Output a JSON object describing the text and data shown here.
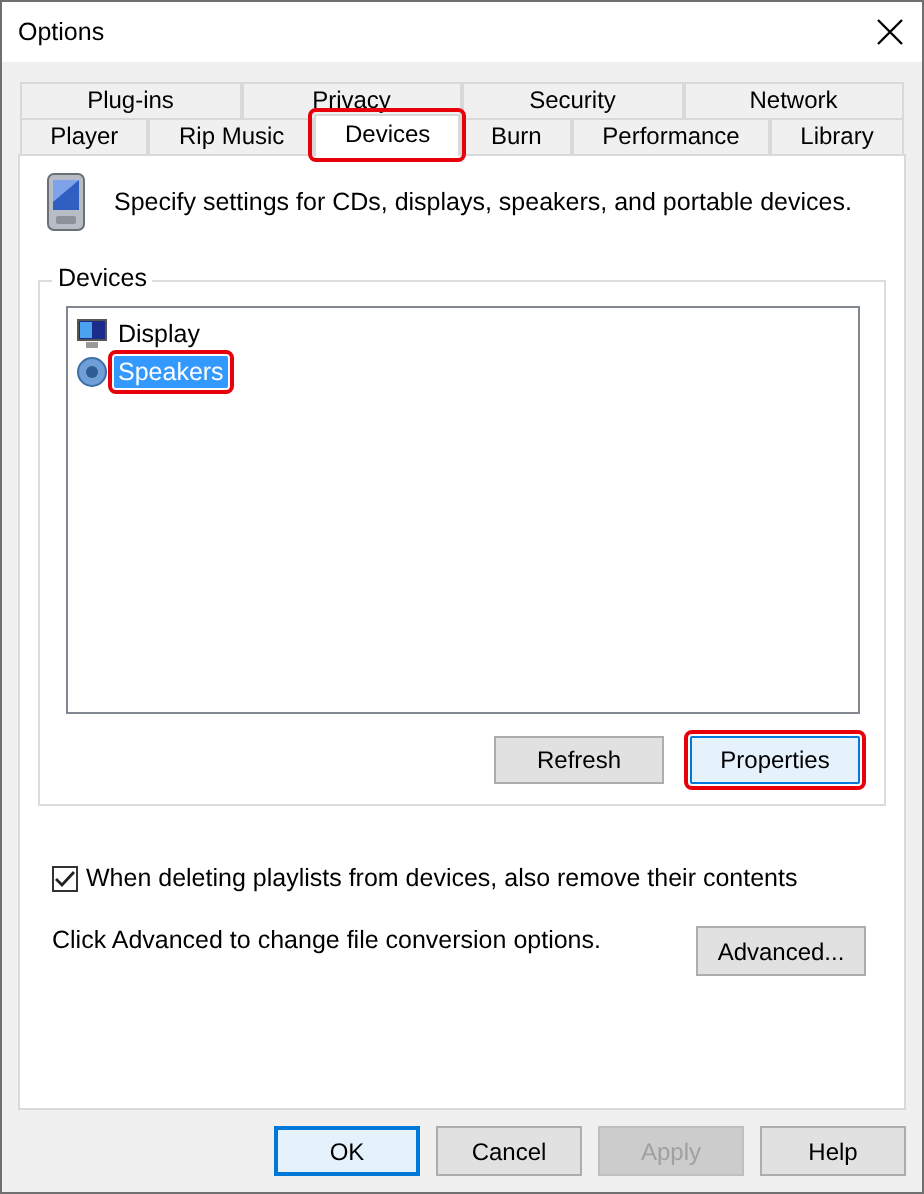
{
  "window": {
    "title": "Options"
  },
  "tab_rows": [
    {
      "tabs": [
        {
          "label": "Plug-ins",
          "selected": false,
          "highlighted": false
        },
        {
          "label": "Privacy",
          "selected": false,
          "highlighted": false
        },
        {
          "label": "Security",
          "selected": false,
          "highlighted": false
        },
        {
          "label": "Network",
          "selected": false,
          "highlighted": false
        }
      ]
    },
    {
      "tabs": [
        {
          "label": "Player",
          "selected": false,
          "highlighted": false
        },
        {
          "label": "Rip Music",
          "selected": false,
          "highlighted": false
        },
        {
          "label": "Devices",
          "selected": true,
          "highlighted": true
        },
        {
          "label": "Burn",
          "selected": false,
          "highlighted": false
        },
        {
          "label": "Performance",
          "selected": false,
          "highlighted": false
        },
        {
          "label": "Library",
          "selected": false,
          "highlighted": false
        }
      ]
    }
  ],
  "description": "Specify settings for CDs, displays, speakers, and portable devices.",
  "devices_group": {
    "label": "Devices",
    "items": [
      {
        "kind": "monitor",
        "label": "Display",
        "selected": false,
        "highlighted": false
      },
      {
        "kind": "speaker",
        "label": "Speakers",
        "selected": true,
        "highlighted": true
      }
    ],
    "buttons": [
      {
        "label": "Refresh",
        "default": false,
        "highlighted": false
      },
      {
        "label": "Properties",
        "default": true,
        "highlighted": true
      }
    ]
  },
  "remove_contents": {
    "label": "When deleting playlists from devices, also remove their contents",
    "checked": true
  },
  "conversion": {
    "text": "Click Advanced to change file conversion options.",
    "button": "Advanced..."
  },
  "footer_buttons": [
    {
      "label": "OK",
      "default": true,
      "disabled": false
    },
    {
      "label": "Cancel",
      "default": false,
      "disabled": false
    },
    {
      "label": "Apply",
      "default": false,
      "disabled": true
    },
    {
      "label": "Help",
      "default": false,
      "disabled": false
    }
  ]
}
